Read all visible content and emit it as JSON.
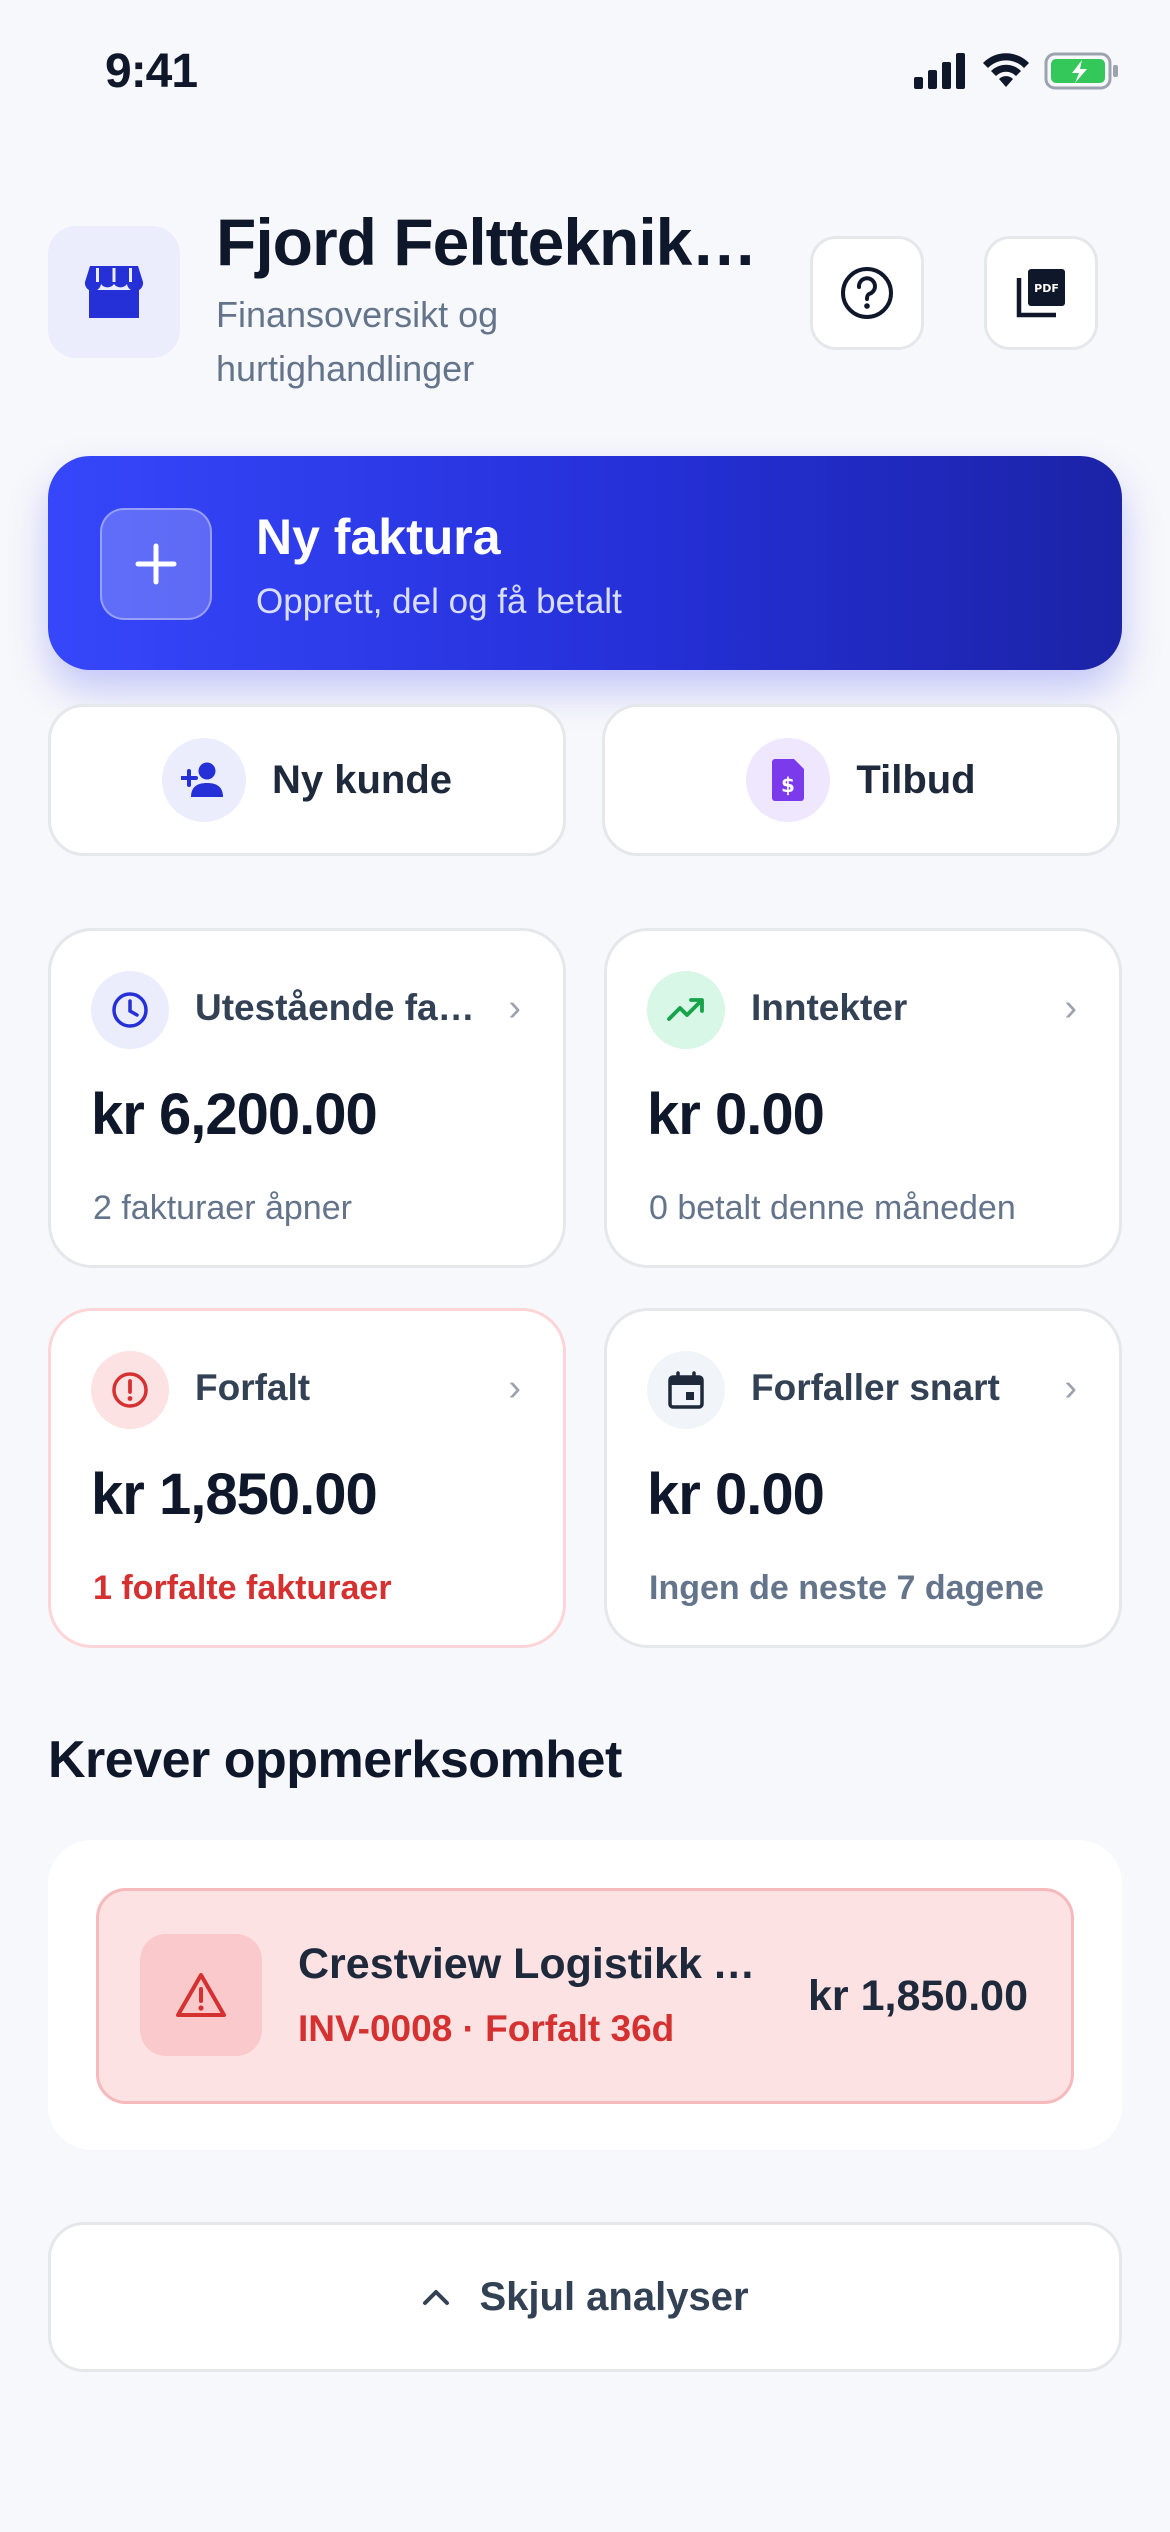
{
  "status_bar": {
    "time": "9:41"
  },
  "header": {
    "business_name": "Fjord Feltteknikk AS",
    "subtitle": "Finansoversikt og hurtighandlinger",
    "help_icon": "help-circle-icon",
    "pdf_icon": "pdf-icon"
  },
  "hero": {
    "title": "Ny faktura",
    "subtitle": "Opprett, del og få betalt"
  },
  "quick_actions": [
    {
      "label": "Ny kunde",
      "icon": "add-person-icon"
    },
    {
      "label": "Tilbud",
      "icon": "estimate-document-icon"
    }
  ],
  "stats": [
    {
      "title": "Utestående fakturaer",
      "amount": "kr 6,200.00",
      "sub": "2 fakturaer åpner",
      "icon": "clock-icon"
    },
    {
      "title": "Inntekter",
      "amount": "kr 0.00",
      "sub": "0 betalt denne måneden",
      "icon": "trending-up-icon"
    },
    {
      "title": "Forfalt",
      "amount": "kr 1,850.00",
      "sub": "1 forfalte fakturaer",
      "icon": "alert-circle-icon"
    },
    {
      "title": "Forfaller snart",
      "amount": "kr 0.00",
      "sub": "Ingen de neste 7 dagene",
      "icon": "calendar-icon"
    }
  ],
  "attention": {
    "title": "Krever oppmerksomhet",
    "items": [
      {
        "name": "Crestview Logistikk AS",
        "meta": "INV-0008 · Forfalt 36d",
        "amount": "kr 1,850.00",
        "icon": "warning-triangle-icon"
      }
    ]
  },
  "toggle_analytics": {
    "label": "Skjul analyser",
    "icon": "chevron-up-icon"
  },
  "colors": {
    "accent": "#2f3ef0",
    "danger": "#d63131",
    "success": "#16a34a",
    "purple": "#7c3aed"
  }
}
